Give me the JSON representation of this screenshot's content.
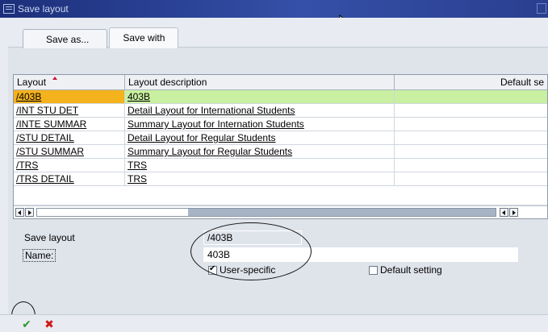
{
  "window": {
    "title": "Save layout"
  },
  "tabs": [
    {
      "label": "Save as...",
      "active": true
    },
    {
      "label": "Save with",
      "active": false
    }
  ],
  "grid": {
    "columns": [
      "Layout",
      "Layout description",
      "Default se"
    ],
    "rows": [
      {
        "layout": "/403B",
        "description": "403B",
        "selected": true
      },
      {
        "layout": "/INT STU DET",
        "description": "Detail Layout for International Students",
        "selected": false
      },
      {
        "layout": "/INTE SUMMAR",
        "description": "Summary Layout for  Internation Students",
        "selected": false
      },
      {
        "layout": "/STU DETAIL",
        "description": "Detail Layout for  Regular Students",
        "selected": false
      },
      {
        "layout": "/STU SUMMAR",
        "description": "Summary Layout for  Regular Students",
        "selected": false
      },
      {
        "layout": "/TRS",
        "description": "TRS",
        "selected": false
      },
      {
        "layout": "/TRS DETAIL",
        "description": "TRS",
        "selected": false
      }
    ]
  },
  "form": {
    "save_layout_label": "Save layout",
    "save_layout_value": "/403B",
    "name_label": "Name:",
    "name_value": "403B",
    "user_specific_label": "User-specific",
    "user_specific_checked": true,
    "default_setting_label": "Default setting",
    "default_setting_checked": false
  },
  "toolbar": {
    "ok_icon": "checkmark-icon",
    "cancel_icon": "cancel-x-icon"
  },
  "colors": {
    "titlebar": "#2a3f8f",
    "selected_key_cell": "#f4b21d",
    "selected_row": "#c8f0a0",
    "ok_green": "#2c9a2c",
    "cancel_red": "#d01a1a"
  }
}
